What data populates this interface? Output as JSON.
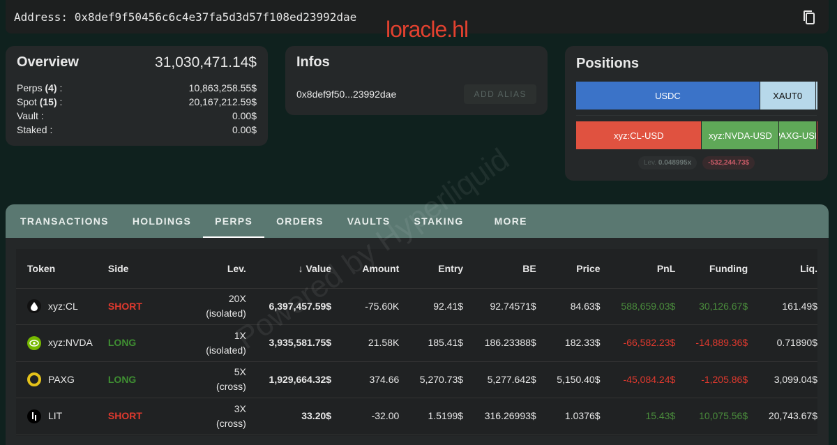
{
  "header": {
    "address_label": "Address:",
    "address": "0x8def9f50456c6c4e37fa5d3d57f108ed23992dae",
    "brand": "loracle.hl"
  },
  "overview": {
    "title": "Overview",
    "total": "31,030,471.14$",
    "rows": [
      {
        "label": "Perps",
        "count": "(4)",
        "suffix": " :",
        "value": "10,863,258.55$"
      },
      {
        "label": "Spot",
        "count": "(15)",
        "suffix": " :",
        "value": "20,167,212.59$"
      },
      {
        "label": "Vault :",
        "count": "",
        "suffix": "",
        "value": "0.00$"
      },
      {
        "label": "Staked :",
        "count": "",
        "suffix": "",
        "value": "0.00$"
      }
    ]
  },
  "infos": {
    "title": "Infos",
    "short_address": "0x8def9f50...23992dae",
    "add_alias": "ADD ALIAS"
  },
  "positions": {
    "title": "Positions",
    "spot": [
      {
        "label": "USDC",
        "share": 0.76,
        "color": "#3b73c8",
        "text": "#fff"
      },
      {
        "label": "XAUT0",
        "share": 0.23,
        "color": "#b7d8ea",
        "text": "#111"
      }
    ],
    "perps": [
      {
        "label": "xyz:CL-USD",
        "share": 0.52,
        "color": "#e05240",
        "text": "#fff"
      },
      {
        "label": "xyz:NVDA-USD",
        "share": 0.32,
        "color": "#5fa858",
        "text": "#fff"
      },
      {
        "label": "PAXG-USD",
        "share": 0.155,
        "color": "#5fa858",
        "text": "#fff"
      }
    ],
    "lev_label": "Lev.",
    "lev_value": "0.048995x",
    "pnl": "-532,244.73$"
  },
  "tabs": [
    "TRANSACTIONS",
    "HOLDINGS",
    "PERPS",
    "ORDERS",
    "VAULTS",
    "STAKING",
    "MORE"
  ],
  "active_tab": "PERPS",
  "table": {
    "headers": [
      "Token",
      "Side",
      "Lev.",
      "↓ Value",
      "Amount",
      "Entry",
      "BE",
      "Price",
      "PnL",
      "Funding",
      "Liq."
    ],
    "rows": [
      {
        "token": "xyz:CL",
        "icon": "oil-drop-icon",
        "side": "SHORT",
        "lev": "20X",
        "mode": "(isolated)",
        "value": "6,397,457.59$",
        "amount": "-75.60K",
        "entry": "92.41$",
        "be": "92.74571$",
        "price": "84.63$",
        "pnl": "588,659.03$",
        "funding": "30,126.67$",
        "liq": "161.49$"
      },
      {
        "token": "xyz:NVDA",
        "icon": "nvidia-icon",
        "side": "LONG",
        "lev": "1X",
        "mode": "(isolated)",
        "value": "3,935,581.75$",
        "amount": "21.58K",
        "entry": "185.41$",
        "be": "186.23388$",
        "price": "182.33$",
        "pnl": "-66,582.23$",
        "funding": "-14,889.36$",
        "liq": "0.71890$"
      },
      {
        "token": "PAXG",
        "icon": "paxg-icon",
        "side": "LONG",
        "lev": "5X",
        "mode": "(cross)",
        "value": "1,929,664.32$",
        "amount": "374.66",
        "entry": "5,270.73$",
        "be": "5,277.642$",
        "price": "5,150.40$",
        "pnl": "-45,084.24$",
        "funding": "-1,205.86$",
        "liq": "3,099.04$"
      },
      {
        "token": "LIT",
        "icon": "lit-icon",
        "side": "SHORT",
        "lev": "3X",
        "mode": "(cross)",
        "value": "33.20$",
        "amount": "-32.00",
        "entry": "1.5199$",
        "be": "316.26993$",
        "price": "1.0376$",
        "pnl": "15.43$",
        "funding": "10,075.56$",
        "liq": "20,743.67$"
      }
    ]
  },
  "watermark": "Powered by Hyperliquid"
}
